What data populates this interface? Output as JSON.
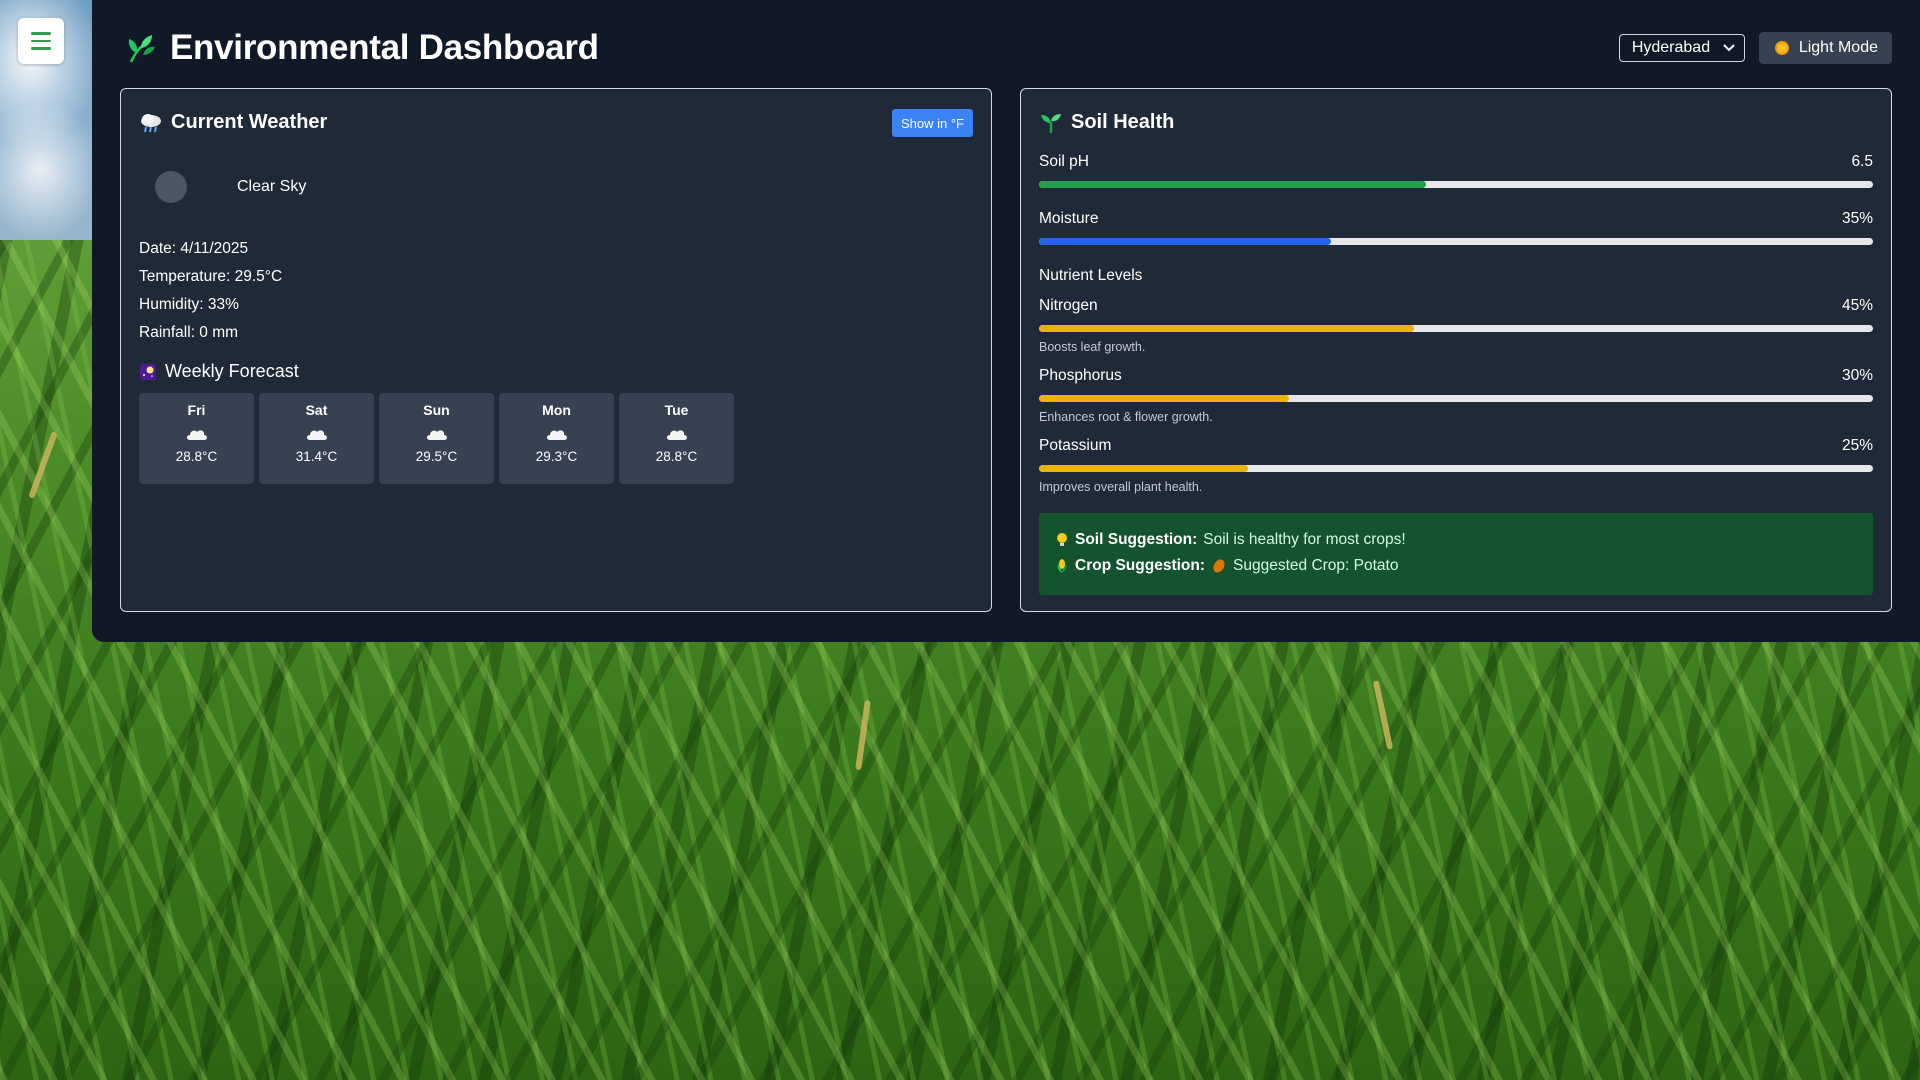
{
  "header": {
    "title": "Environmental Dashboard",
    "logo_icon": "leaf-icon",
    "city": {
      "selected": "Hyderabad"
    },
    "theme_toggle": {
      "label": "Light Mode",
      "icon": "sun-icon"
    }
  },
  "menu": {
    "icon": "hamburger-icon"
  },
  "weather": {
    "title": "Current Weather",
    "title_icon": "cloud-rain-icon",
    "unit_toggle_label": "Show in °F",
    "condition": "Clear Sky",
    "details": {
      "date": "Date: 4/11/2025",
      "temperature": "Temperature: 29.5°C",
      "humidity": "Humidity: 33%",
      "rainfall": "Rainfall: 0 mm"
    },
    "forecast_title": "Weekly Forecast",
    "forecast_icon": "night-sky-icon",
    "forecast": [
      {
        "day": "Fri",
        "temp": "28.8°C",
        "icon": "cloud-icon"
      },
      {
        "day": "Sat",
        "temp": "31.4°C",
        "icon": "cloud-icon"
      },
      {
        "day": "Sun",
        "temp": "29.5°C",
        "icon": "cloud-icon"
      },
      {
        "day": "Mon",
        "temp": "29.3°C",
        "icon": "cloud-icon"
      },
      {
        "day": "Tue",
        "temp": "28.8°C",
        "icon": "cloud-icon"
      }
    ]
  },
  "soil": {
    "title": "Soil Health",
    "title_icon": "seedling-icon",
    "ph": {
      "label": "Soil pH",
      "value": "6.5",
      "fraction": 0.464,
      "color": "#22a04b"
    },
    "moisture": {
      "label": "Moisture",
      "value": "35%",
      "fraction": 0.35,
      "color": "#2563eb"
    },
    "nutrients_title": "Nutrient Levels",
    "nutrients": [
      {
        "label": "Nitrogen",
        "value": "45%",
        "fraction": 0.45,
        "description": "Boosts leaf growth.",
        "color": "#eab308"
      },
      {
        "label": "Phosphorus",
        "value": "30%",
        "fraction": 0.3,
        "description": "Enhances root & flower growth.",
        "color": "#eab308"
      },
      {
        "label": "Potassium",
        "value": "25%",
        "fraction": 0.25,
        "description": "Improves overall plant health.",
        "color": "#eab308"
      }
    ],
    "suggestion": {
      "soil_label": "Soil Suggestion:",
      "soil_text": "Soil is healthy for most crops!",
      "soil_icon": "lightbulb-icon",
      "crop_label": "Crop Suggestion:",
      "crop_text": "Suggested Crop: Potato",
      "crop_icon": "corn-icon",
      "crop_item_icon": "potato-icon"
    }
  },
  "colors": {
    "panel": "#111827",
    "card": "#1f2937",
    "accent_blue": "#3b82f6",
    "suggestion_bg": "#14532d"
  }
}
